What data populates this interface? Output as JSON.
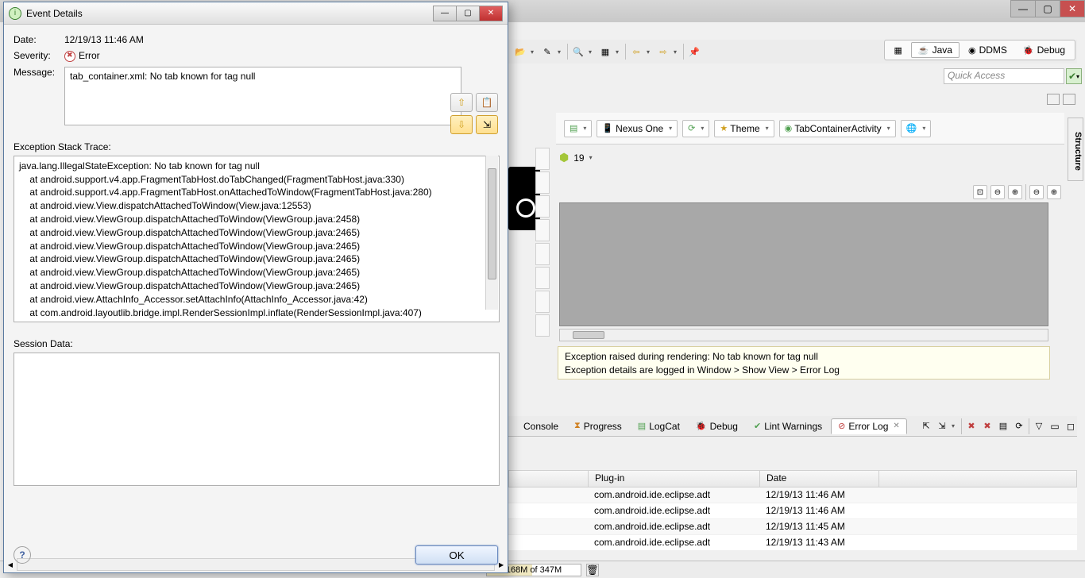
{
  "dialog": {
    "title": "Event Details",
    "labels": {
      "date": "Date:",
      "severity": "Severity:",
      "message": "Message:",
      "stack": "Exception Stack Trace:",
      "session": "Session Data:"
    },
    "date": "12/19/13 11:46 AM",
    "severity": "Error",
    "message": "tab_container.xml: No tab known for tag null",
    "stacktrace": "java.lang.IllegalStateException: No tab known for tag null\n    at android.support.v4.app.FragmentTabHost.doTabChanged(FragmentTabHost.java:330)\n    at android.support.v4.app.FragmentTabHost.onAttachedToWindow(FragmentTabHost.java:280)\n    at android.view.View.dispatchAttachedToWindow(View.java:12553)\n    at android.view.ViewGroup.dispatchAttachedToWindow(ViewGroup.java:2458)\n    at android.view.ViewGroup.dispatchAttachedToWindow(ViewGroup.java:2465)\n    at android.view.ViewGroup.dispatchAttachedToWindow(ViewGroup.java:2465)\n    at android.view.ViewGroup.dispatchAttachedToWindow(ViewGroup.java:2465)\n    at android.view.ViewGroup.dispatchAttachedToWindow(ViewGroup.java:2465)\n    at android.view.ViewGroup.dispatchAttachedToWindow(ViewGroup.java:2465)\n    at android.view.AttachInfo_Accessor.setAttachInfo(AttachInfo_Accessor.java:42)\n    at com.android.layoutlib.bridge.impl.RenderSessionImpl.inflate(RenderSessionImpl.java:407)",
    "ok": "OK"
  },
  "perspectives": {
    "java": "Java",
    "ddms": "DDMS",
    "debug": "Debug"
  },
  "quick_access": {
    "placeholder": "Quick Access"
  },
  "layout_toolbar": {
    "device": "Nexus One",
    "theme": "Theme",
    "activity": "TabContainerActivity",
    "api": "19"
  },
  "render_error": {
    "line1": "Exception raised during rendering: No tab known for tag null",
    "line2": "Exception details are logged in Window > Show View > Error Log"
  },
  "bottom_tabs": {
    "console": "Console",
    "progress": "Progress",
    "logcat": "LogCat",
    "debug": "Debug",
    "lint": "Lint Warnings",
    "errorlog": "Error Log"
  },
  "log_table": {
    "headers": {
      "plugin": "Plug-in",
      "date": "Date"
    },
    "rows": [
      {
        "plugin": "com.android.ide.eclipse.adt",
        "date": "12/19/13 11:46 AM"
      },
      {
        "plugin": "com.android.ide.eclipse.adt",
        "date": "12/19/13 11:46 AM"
      },
      {
        "plugin": "com.android.ide.eclipse.adt",
        "date": "12/19/13 11:45 AM"
      },
      {
        "plugin": "com.android.ide.eclipse.adt",
        "date": "12/19/13 11:43 AM"
      }
    ]
  },
  "status": {
    "heap": "168M of 347M"
  },
  "structure_tab": "Structure"
}
